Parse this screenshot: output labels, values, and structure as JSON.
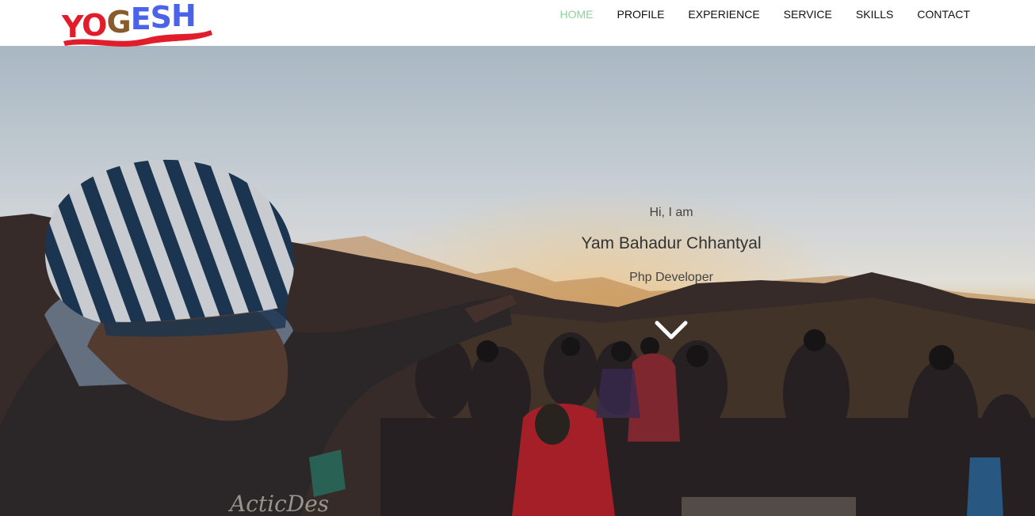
{
  "logo": {
    "letters": [
      "Y",
      "O",
      "G",
      "E",
      "S",
      "H"
    ],
    "colors": {
      "red": "#e11d2b",
      "brown": "#8a5a2b",
      "blue": "#4a63e8"
    }
  },
  "nav": {
    "items": [
      {
        "label": "HOME",
        "active": true
      },
      {
        "label": "PROFILE",
        "active": false
      },
      {
        "label": "EXPERIENCE",
        "active": false
      },
      {
        "label": "SERVICE",
        "active": false
      },
      {
        "label": "SKILLS",
        "active": false
      },
      {
        "label": "CONTACT",
        "active": false
      }
    ],
    "active_color": "#8fd19e"
  },
  "hero": {
    "greeting": "Hi, I am",
    "name": "Yam Bahadur Chhantyal",
    "role": "Php Developer",
    "scroll_icon": "chevron-down-icon"
  }
}
